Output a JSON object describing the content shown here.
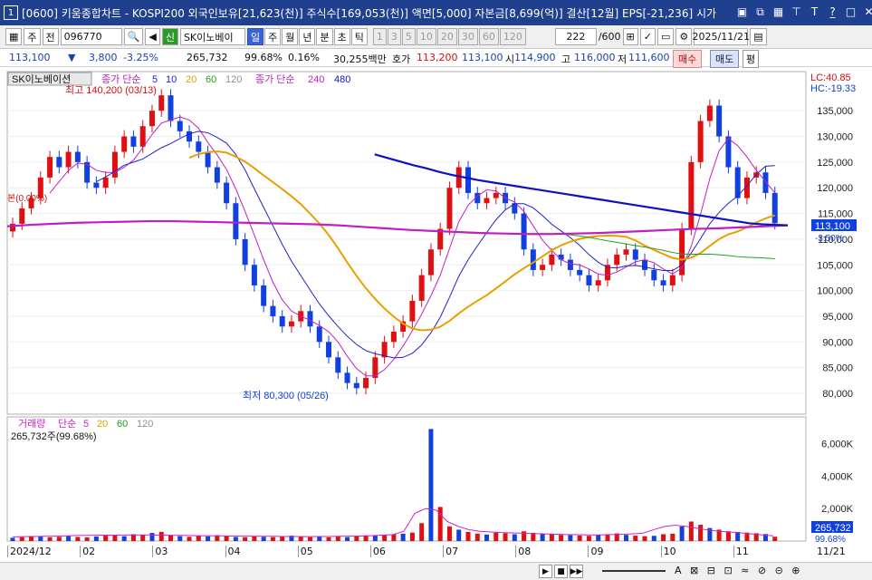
{
  "window": {
    "number": "1",
    "title": "[0600] 키움종합차트 - KOSPI200 외국인보유[21,623(천)] 주식수[169,053(천)] 액면[5,000] 자본금[8,699(억)] 결산[12월] EPS[-21,236] 시가"
  },
  "toolbar": {
    "market": "주",
    "prefix": "전",
    "code": "096770",
    "stock_name": "SK이노베이",
    "period_tabs": [
      "일",
      "주",
      "월",
      "년",
      "분",
      "초",
      "틱"
    ],
    "intervals": [
      "1",
      "3",
      "5",
      "10",
      "20",
      "30",
      "60",
      "120"
    ],
    "count": "222",
    "count_max": "/600",
    "date": "2025/11/21"
  },
  "quote": {
    "price": "113,100",
    "change": "3,800",
    "change_pct": "-3.25%",
    "volume": "265,732",
    "vol_ratio": "99.68%",
    "turnover": "0.16%",
    "amount": "30,255백만",
    "ask_label": "호가",
    "ask": "113,200",
    "bid": "113,100",
    "open_label": "시",
    "open": "114,900",
    "high_label": "고",
    "high": "116,000",
    "low_label": "저",
    "low": "111,600",
    "buy": "매수",
    "sell": "매도",
    "flat": "평"
  },
  "price_panel": {
    "stock_label": "SK이노베이션",
    "legend_prefix": "종가 단순",
    "ma": [
      {
        "label": "5",
        "color": "#2020d0"
      },
      {
        "label": "10",
        "color": "#2020d0"
      },
      {
        "label": "20",
        "color": "#e8a000"
      },
      {
        "label": "60",
        "color": "#20a020"
      },
      {
        "label": "120",
        "color": "#909090"
      }
    ],
    "legend2_prefix": "종가 단순",
    "ma2": [
      {
        "label": "240",
        "color": "#c020c0"
      },
      {
        "label": "480",
        "color": "#1010c0"
      }
    ],
    "high_note": "최고 140,200 (03/13)",
    "low_note": "최저 80,300 (05/26)",
    "left_note": "본(0.00%)",
    "lc": "LC:40.85",
    "hc": "HC:-19.33",
    "last_price": "113,100",
    "last_pct": "-3.50%",
    "y_ticks": [
      "135,000",
      "130,000",
      "125,000",
      "120,000",
      "115,000",
      "110,000",
      "105,000",
      "100,000",
      "95,000",
      "90,000",
      "85,000",
      "80,000"
    ]
  },
  "volume_panel": {
    "legend_label": "거래량",
    "legend_prefix": "단순",
    "ma": [
      {
        "label": "5",
        "color": "#d020d0"
      },
      {
        "label": "20",
        "color": "#e8a000"
      },
      {
        "label": "60",
        "color": "#20a020"
      },
      {
        "label": "120",
        "color": "#909090"
      }
    ],
    "summary": "265,732주(99.68%)",
    "y_ticks": [
      "6,000K",
      "4,000K",
      "2,000K"
    ],
    "last_vol": "265,732",
    "last_pct": "99.68%"
  },
  "x_axis": {
    "labels": [
      "2024/12",
      "02",
      "03",
      "04",
      "05",
      "06",
      "07",
      "08",
      "09",
      "10",
      "11"
    ],
    "right_label": "11/21"
  },
  "chart_data": {
    "type": "candlestick",
    "y_range": [
      77000,
      140500
    ],
    "vol_range": [
      0,
      7200
    ],
    "close": [
      113000,
      116000,
      118000,
      122000,
      126000,
      124000,
      127000,
      125000,
      121000,
      120000,
      122000,
      127000,
      130000,
      128000,
      132000,
      135000,
      138000,
      133000,
      131000,
      129000,
      127000,
      124000,
      121000,
      117000,
      110000,
      105000,
      101000,
      97000,
      95000,
      93000,
      94000,
      96000,
      93000,
      90000,
      87000,
      84000,
      82000,
      81000,
      83000,
      87000,
      90000,
      92000,
      94000,
      98000,
      103000,
      108000,
      112000,
      120000,
      124000,
      119000,
      117000,
      118000,
      119000,
      117000,
      115000,
      108000,
      104000,
      105000,
      107000,
      106000,
      104000,
      103000,
      101000,
      102000,
      105000,
      107000,
      108000,
      106000,
      104000,
      102000,
      101000,
      103000,
      112000,
      125000,
      133000,
      136000,
      130000,
      124000,
      118000,
      122000,
      123000,
      119000,
      113100
    ],
    "ma240": [
      112500,
      112800,
      113000,
      113200,
      113300,
      113400,
      113500,
      113500,
      113400,
      113300,
      113200,
      113100,
      113000,
      112900,
      112700,
      112400,
      112100,
      111800,
      111600,
      111400,
      111200,
      111100,
      111000,
      111000,
      111100,
      111200,
      111400,
      111600,
      111800,
      112000,
      112100,
      112300,
      112500,
      112700
    ],
    "ma480_start": 0.46,
    "ma480": [
      126500,
      125800,
      125100,
      124400,
      123800,
      123100,
      122500,
      122000,
      121500,
      121100,
      120700,
      120300,
      119900,
      119500,
      119100,
      118700,
      118300,
      117900,
      117500,
      117100,
      116700,
      116300,
      115900,
      115500,
      115100,
      114700,
      114300,
      113900,
      113500,
      113100,
      112900,
      112800,
      112700
    ],
    "volume": [
      200,
      240,
      310,
      280,
      230,
      260,
      300,
      250,
      220,
      280,
      330,
      360,
      300,
      420,
      380,
      500,
      560,
      360,
      300,
      260,
      320,
      290,
      360,
      300,
      250,
      230,
      280,
      260,
      240,
      300,
      330,
      260,
      240,
      280,
      230,
      280,
      240,
      300,
      350,
      330,
      380,
      420,
      450,
      520,
      1100,
      6900,
      2100,
      900,
      700,
      560,
      450,
      400,
      520,
      480,
      420,
      600,
      500,
      450,
      420,
      380,
      360,
      340,
      320,
      380,
      420,
      470,
      380,
      330,
      300,
      320,
      420,
      450,
      900,
      1200,
      1000,
      800,
      700,
      600,
      560,
      520,
      480,
      430,
      265
    ],
    "vol_ma5": [
      260,
      270,
      280,
      290,
      300,
      320,
      340,
      350,
      360,
      360,
      370,
      380,
      380,
      370,
      360,
      350,
      340,
      330,
      330,
      320,
      310,
      300,
      300,
      290,
      290,
      280,
      280,
      270,
      280,
      280,
      290,
      300,
      310,
      330,
      360,
      400,
      600,
      1700,
      2000,
      1900,
      1200,
      900,
      700,
      600,
      560,
      520,
      500,
      480,
      460,
      440,
      420,
      400,
      390,
      380,
      380,
      400,
      420,
      440,
      480,
      700,
      900,
      980,
      900,
      780,
      680,
      600,
      560,
      500,
      440,
      380,
      320
    ]
  }
}
